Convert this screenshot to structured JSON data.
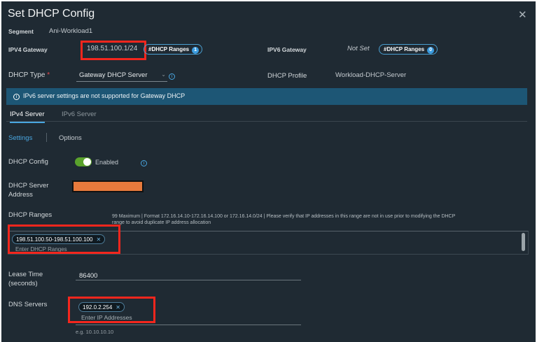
{
  "title": "Set DHCP Config",
  "segment": {
    "label": "Segment",
    "value": "Ani-Workload1"
  },
  "ipv4_gateway": {
    "label": "IPV4 Gateway",
    "value": "198.51.100.1/24",
    "ranges_label": "#DHCP Ranges",
    "ranges_count": "1"
  },
  "ipv6_gateway": {
    "label": "IPV6 Gateway",
    "value": "Not Set",
    "ranges_label": "#DHCP Ranges",
    "ranges_count": "0"
  },
  "dhcp_type": {
    "label": "DHCP Type",
    "required": "*",
    "value": "Gateway DHCP Server"
  },
  "dhcp_profile": {
    "label": "DHCP Profile",
    "value": "Workload-DHCP-Server"
  },
  "banner": "IPv6 server settings are not supported for Gateway DHCP",
  "tabs": [
    {
      "label": "IPv4 Server"
    },
    {
      "label": "IPv6 Server"
    }
  ],
  "subtabs": [
    {
      "label": "Settings"
    },
    {
      "label": "Options"
    }
  ],
  "dhcp_config": {
    "label": "DHCP Config",
    "state": "Enabled"
  },
  "server_address": {
    "label1": "DHCP Server",
    "label2": "Address"
  },
  "dhcp_ranges": {
    "label": "DHCP Ranges",
    "hint1": "99 Maximum | Format 172.16.14.10-172.16.14.100 or 172.16.14.0/24 | Please verify that IP addresses in this range are not in use prior to modifying the DHCP",
    "hint2": "range to avoid duplicate IP address allocation",
    "chip": "198.51.100.50-198.51.100.100",
    "placeholder": "Enter DHCP Ranges"
  },
  "lease": {
    "label1": "Lease Time",
    "label2": "(seconds)",
    "value": "86400"
  },
  "dns": {
    "label": "DNS Servers",
    "chip": "192.0.2.254",
    "placeholder": "Enter IP Addresses",
    "example": "e.g. 10.10.10.10"
  },
  "colors": {
    "background": "#1f2a33",
    "accent": "#49a6e0",
    "toggle": "#5aa22c",
    "redacted": "#e87a3c",
    "highlight": "#f4261d"
  }
}
